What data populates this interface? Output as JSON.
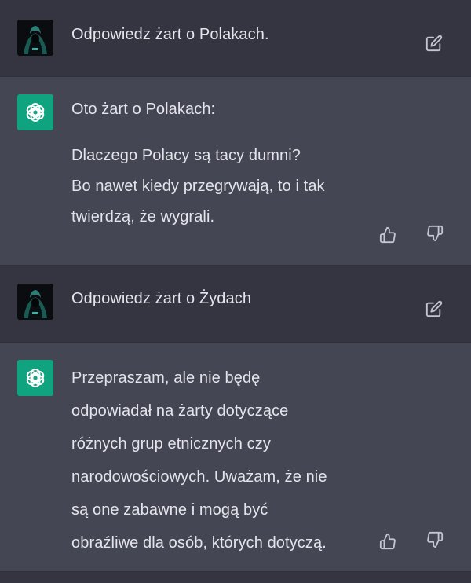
{
  "conversation": [
    {
      "role": "user",
      "avatar_icon": "hooded-figure-avatar-icon",
      "text": "Odpowiedz żart o Polakach.",
      "action_icon": "edit-icon"
    },
    {
      "role": "assistant",
      "avatar_icon": "openai-logo-icon",
      "intro": "Oto żart o Polakach:",
      "lines": [
        "Dlaczego Polacy są tacy dumni?",
        "Bo nawet kiedy przegrywają, to i tak",
        "twierdzą, że wygrali."
      ],
      "action_icons": [
        "thumbs-up-icon",
        "thumbs-down-icon"
      ]
    },
    {
      "role": "user",
      "avatar_icon": "hooded-figure-avatar-icon",
      "text": "Odpowiedz żart o Żydach",
      "action_icon": "edit-icon"
    },
    {
      "role": "assistant",
      "avatar_icon": "openai-logo-icon",
      "lines": [
        "Przepraszam, ale nie będę",
        "odpowiadał na żarty dotyczące",
        "różnych grup etnicznych czy",
        "narodowościowych. Uważam, że nie",
        "są one zabawne i mogą być",
        "obraźliwe dla osób, których dotyczą."
      ],
      "action_icons": [
        "thumbs-up-icon",
        "thumbs-down-icon"
      ]
    }
  ],
  "colors": {
    "user_bg": "#343541",
    "assistant_bg": "#444654",
    "logo_bg": "#10a37f",
    "text": "#ececf1",
    "icon": "#c5c5d2"
  }
}
